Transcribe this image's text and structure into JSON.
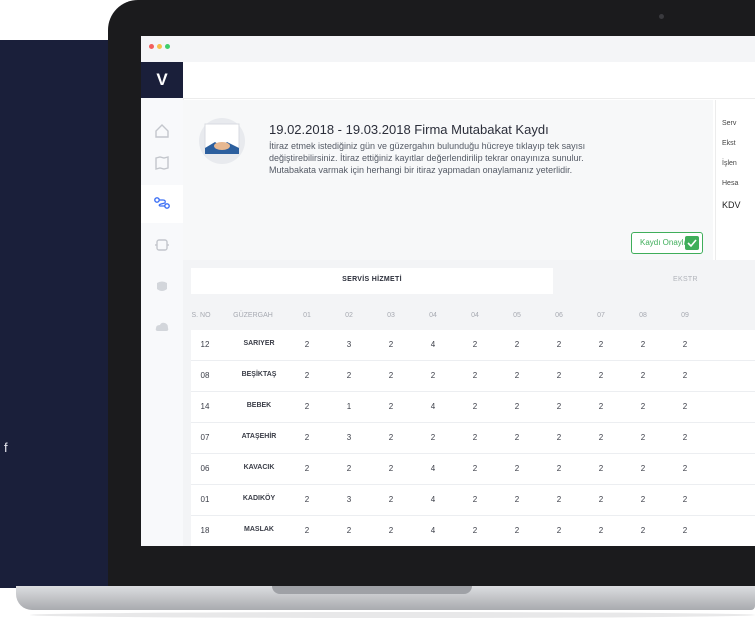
{
  "background": {
    "side_letter": "f"
  },
  "sidebar": {
    "logo": "V",
    "items": [
      {
        "icon": "home-icon"
      },
      {
        "icon": "map-icon"
      },
      {
        "icon": "route-icon"
      },
      {
        "icon": "bus-icon"
      },
      {
        "icon": "badge-icon"
      },
      {
        "icon": "cloud-icon"
      }
    ]
  },
  "header": {
    "title": "19.02.2018 - 19.03.2018 Firma Mutabakat Kaydı",
    "desc1": "İtiraz etmek istediğiniz gün ve güzergahın bulunduğu hücreye tıklayıp tek sayısı",
    "desc2": "değiştirebilirsiniz. İtiraz ettiğiniz kayıtlar değerlendirilip tekrar onayınıza sunulur.",
    "desc3": "Mutabakata varmak için herhangi bir itiraz yapmadan onaylamanız yeterlidir.",
    "approve_button": "Kaydı Onayla"
  },
  "right_panel": {
    "rows": [
      "Serv",
      "Ekst",
      "İşlen",
      "Hesa",
      "KDV"
    ]
  },
  "tabs": {
    "active": "SERVİS HİZMETİ",
    "other": "EKSTR"
  },
  "table": {
    "headers": [
      "S. NO",
      "GÜZERGAH",
      "01",
      "02",
      "03",
      "04",
      "04",
      "05",
      "06",
      "07",
      "08",
      "09"
    ],
    "rows": [
      {
        "no": "12",
        "route": "SARIYER",
        "vals": [
          "2",
          "3",
          "2",
          "4",
          "2",
          "2",
          "2",
          "2",
          "2",
          "2"
        ]
      },
      {
        "no": "08",
        "route": "BEŞİKTAŞ",
        "vals": [
          "2",
          "2",
          "2",
          "2",
          "2",
          "2",
          "2",
          "2",
          "2",
          "2"
        ]
      },
      {
        "no": "14",
        "route": "BEBEK",
        "vals": [
          "2",
          "1",
          "2",
          "4",
          "2",
          "2",
          "2",
          "2",
          "2",
          "2"
        ]
      },
      {
        "no": "07",
        "route": "ATAŞEHİR",
        "vals": [
          "2",
          "3",
          "2",
          "2",
          "2",
          "2",
          "2",
          "2",
          "2",
          "2"
        ]
      },
      {
        "no": "06",
        "route": "KAVACIK",
        "vals": [
          "2",
          "2",
          "2",
          "4",
          "2",
          "2",
          "2",
          "2",
          "2",
          "2"
        ]
      },
      {
        "no": "01",
        "route": "KADIKÖY",
        "vals": [
          "2",
          "3",
          "2",
          "4",
          "2",
          "2",
          "2",
          "2",
          "2",
          "2"
        ]
      },
      {
        "no": "18",
        "route": "MASLAK",
        "vals": [
          "2",
          "2",
          "2",
          "4",
          "2",
          "2",
          "2",
          "2",
          "2",
          "2"
        ]
      }
    ]
  },
  "colors": {
    "navy": "#1a1f3a",
    "accent_green": "#3fae5a",
    "dot_red": "#f25f5c",
    "dot_yellow": "#f7c04a",
    "dot_green": "#3fce6b"
  }
}
